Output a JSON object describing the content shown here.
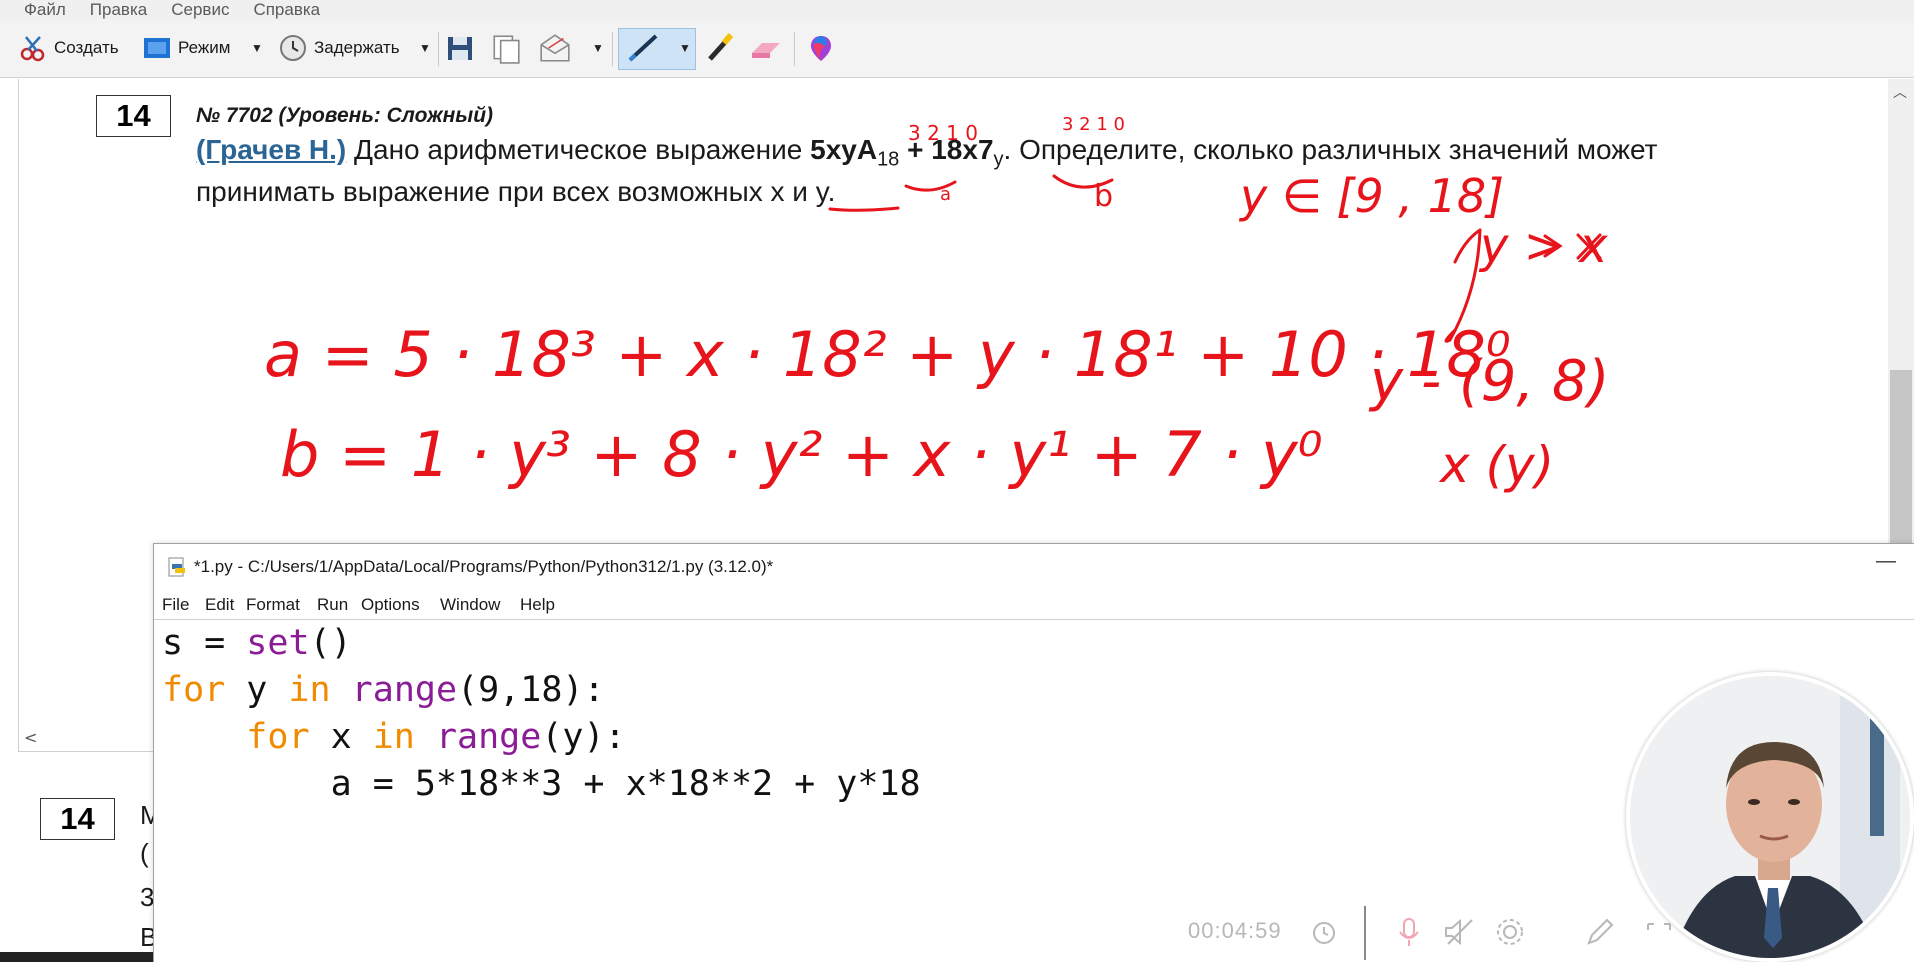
{
  "app": {
    "menu": [
      "Файл",
      "Правка",
      "Сервис",
      "Справка"
    ],
    "toolbar": {
      "create_label": "Создать",
      "mode_label": "Режим",
      "delay_label": "Задержать"
    }
  },
  "document": {
    "question_number": "14",
    "title": "№ 7702 (Уровень: Сложный)",
    "author": "(Грачев Н.)",
    "text_before": " Дано арифметическое выражение ",
    "expr1": "5xyA",
    "base1": "18",
    "plus": " + ",
    "expr2": "18x7",
    "base2": "y",
    "text_after": ". Определите, сколько различных значений может",
    "line2_before": "принимать выражение при всех возможных ",
    "line2_vars": "x и y",
    "line2_end": ".",
    "second_question_number": "14",
    "second_frag_a": "(",
    "second_frag_b": "3",
    "second_frag_c": "В",
    "second_frag_m": "М"
  },
  "handwriting": {
    "digits_over_a": "3 2 1 0",
    "digits_over_b": "3 2 1 0",
    "under_a": "a",
    "under_b": "b",
    "range": "y ∈ [9 , 18]",
    "relation": "y > x",
    "line_a": "a = 5 · 18³ + x · 18² + y · 18¹ + 10 · 18⁰",
    "line_b": "b = 1 · y³ + 8 · y² + x · y¹ + 7 · y⁰",
    "y_range": "y - (9, 8)",
    "x_range": "x  (y)"
  },
  "idle": {
    "title": "*1.py - C:/Users/1/AppData/Local/Programs/Python/Python312/1.py (3.12.0)*",
    "menu": [
      "File",
      "Edit",
      "Format",
      "Run",
      "Options",
      "Window",
      "Help"
    ],
    "code": {
      "l1_a": "s = ",
      "l1_b": "set",
      "l1_c": "()",
      "l2_a": "for",
      "l2_b": " y ",
      "l2_c": "in",
      "l2_d": " ",
      "l2_e": "range",
      "l2_f": "(9,18):",
      "l3_a": "    ",
      "l3_b": "for",
      "l3_c": " x ",
      "l3_d": "in",
      "l3_e": " ",
      "l3_f": "range",
      "l3_g": "(y):",
      "l4": "        a = 5*18**3 + x*18**2 + y*18"
    }
  },
  "recorder": {
    "time": "00:04:59"
  },
  "colors": {
    "ink": "#e8141c",
    "keyword": "#f08a00",
    "builtin": "#8a1d96",
    "link": "#2a6596"
  }
}
